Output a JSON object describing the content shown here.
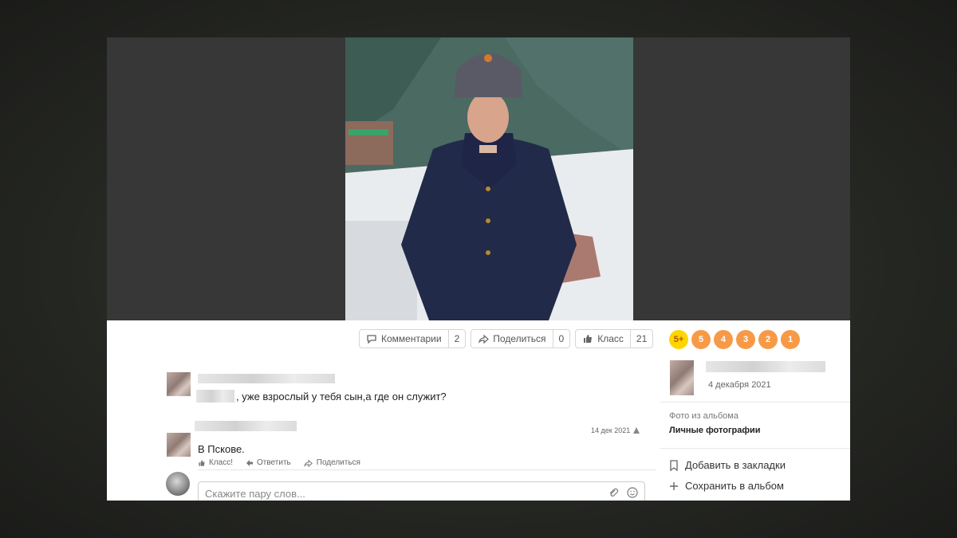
{
  "actions": {
    "comments": {
      "label": "Комментарии",
      "count": "2"
    },
    "share": {
      "label": "Поделиться",
      "count": "0"
    },
    "like": {
      "label": "Класс",
      "count": "21"
    }
  },
  "ratings": [
    "5+",
    "5",
    "4",
    "3",
    "2",
    "1"
  ],
  "comments": [
    {
      "text": ", уже взрослый у тебя сын,а где он служит?"
    },
    {
      "date": "14 дек 2021",
      "text": "В Пскове."
    }
  ],
  "reply_actions": {
    "like": "Класс!",
    "reply": "Ответить",
    "share": "Поделиться"
  },
  "input": {
    "placeholder": "Скажите пару слов..."
  },
  "right_panel": {
    "date": "4 декабря 2021",
    "album_label": "Фото из альбома",
    "album_name": "Личные фотографии",
    "bookmark": "Добавить в закладки",
    "save": "Сохранить в альбом"
  }
}
